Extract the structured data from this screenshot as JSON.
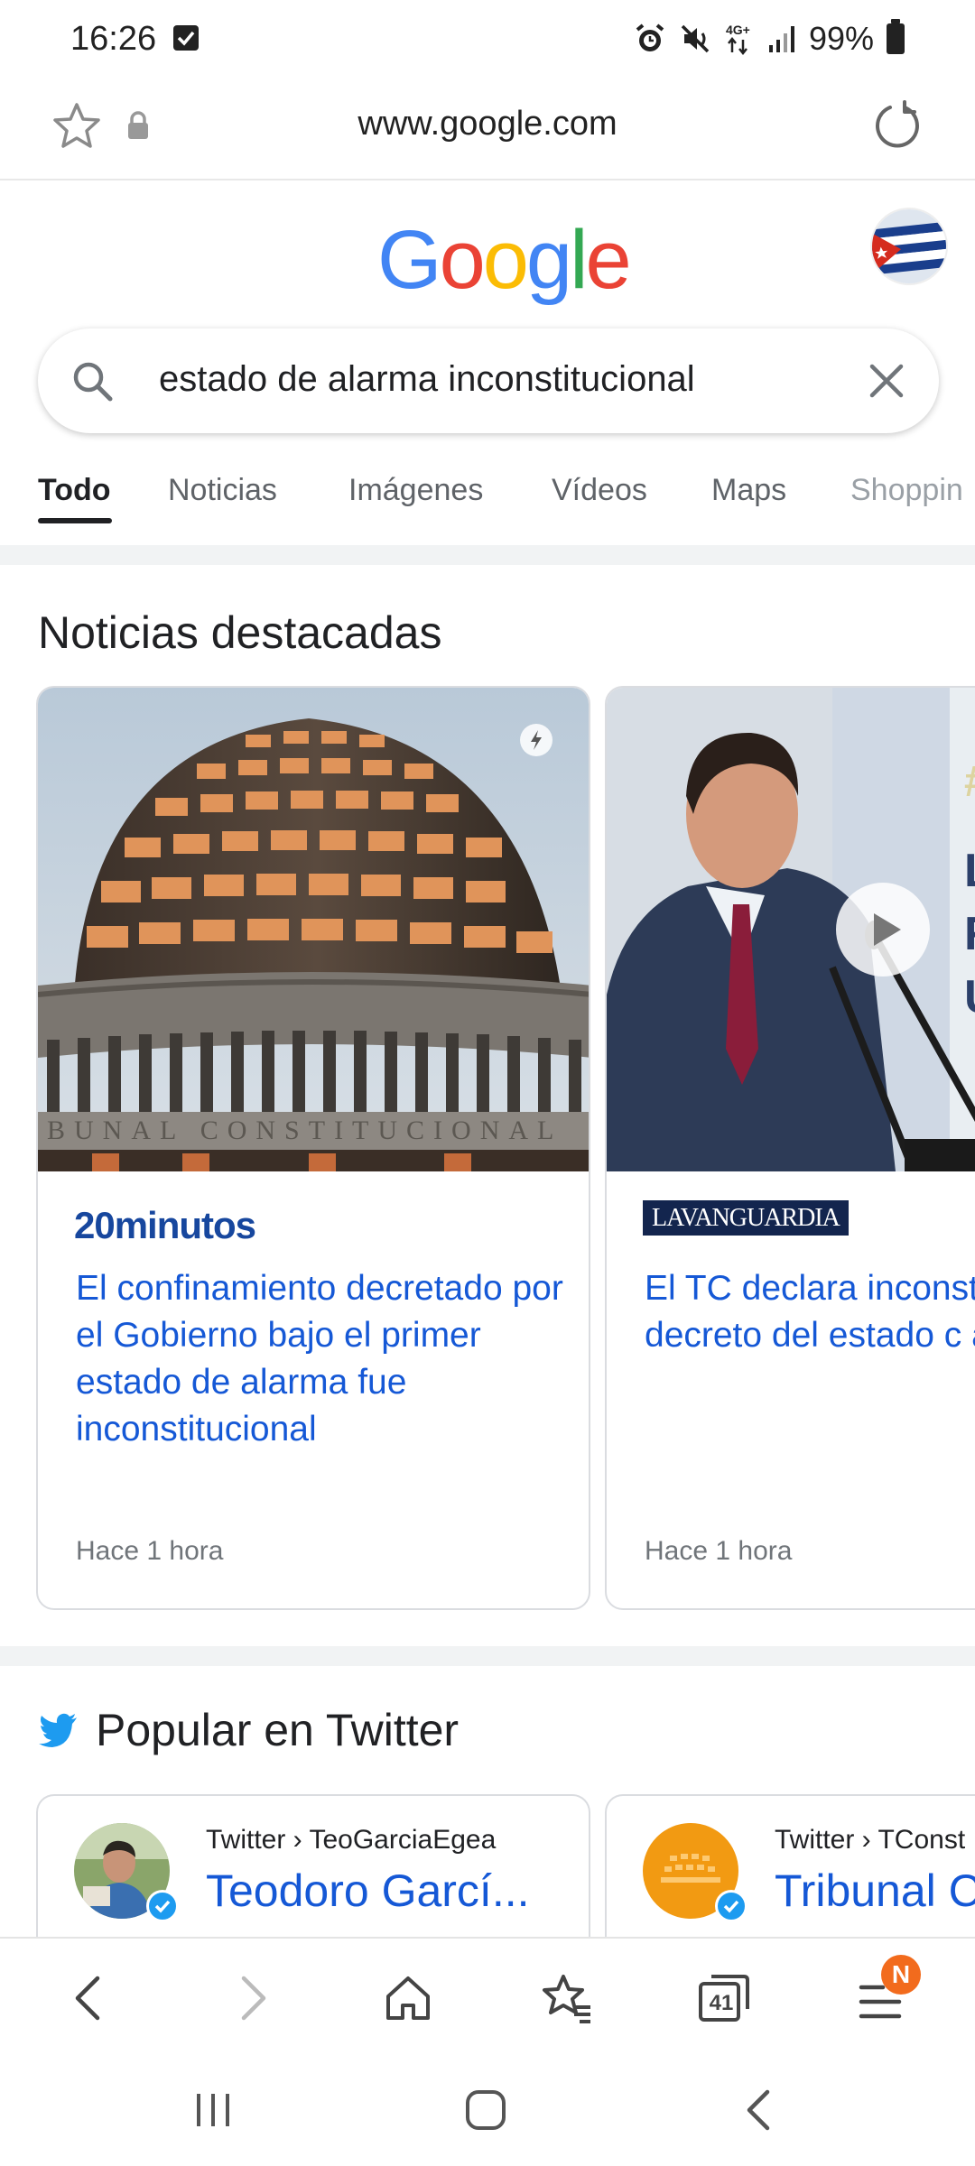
{
  "status_bar": {
    "time": "16:26",
    "network": "4G+",
    "battery": "99%"
  },
  "url_bar": {
    "url": "www.google.com"
  },
  "google": {
    "logo_letters": [
      "G",
      "o",
      "o",
      "g",
      "l",
      "e"
    ],
    "logo_colors": [
      "#4285F4",
      "#EA4335",
      "#FBBC05",
      "#4285F4",
      "#34A853",
      "#EA4335"
    ]
  },
  "search": {
    "query": "estado de alarma inconstitucional"
  },
  "tabs": [
    {
      "label": "Todo",
      "active": true
    },
    {
      "label": "Noticias",
      "active": false
    },
    {
      "label": "Imágenes",
      "active": false
    },
    {
      "label": "Vídeos",
      "active": false
    },
    {
      "label": "Maps",
      "active": false
    },
    {
      "label": "Shoppin",
      "active": false
    }
  ],
  "top_stories": {
    "heading": "Noticias destacadas",
    "cards": [
      {
        "source": "20minutos",
        "title": "El confinamiento decretado por el Gobierno bajo el primer estado de alarma fue inconstitucional",
        "time": "Hace 1 hora",
        "image_caption": "BUNAL CONSTITUCIONAL"
      },
      {
        "source": "LAVANGUARDIA",
        "title": "El TC declara inconstitucional par decreto del estado c alarma",
        "time": "Hace 1 hora"
      }
    ]
  },
  "twitter": {
    "heading": "Popular en Twitter",
    "cards": [
      {
        "path": "Twitter › TeoGarciaEgea",
        "name": "Teodoro Garcí..."
      },
      {
        "path": "Twitter › TConst",
        "name": "Tribunal C"
      }
    ]
  },
  "toolbar": {
    "tabs_count": "41",
    "menu_badge": "N"
  },
  "colors": {
    "link_blue": "#1558d6",
    "twitter_blue": "#1d9bf0",
    "badge_orange": "#f26b1d"
  }
}
